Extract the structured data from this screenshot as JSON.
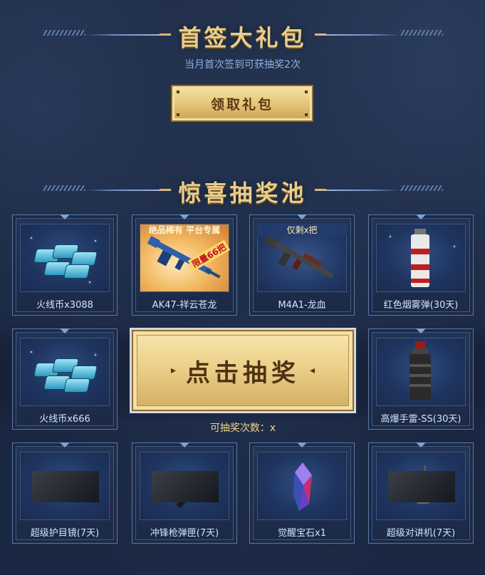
{
  "signin": {
    "title": "首签大礼包",
    "subtitle": "当月首次签到可获抽奖2次",
    "claim_label": "领取礼包"
  },
  "lottery": {
    "title": "惊喜抽奖池",
    "draw_label": "点击抽奖",
    "draws_left": "可抽奖次数：x"
  },
  "prizes": [
    {
      "label": "火线币x3088",
      "icon": "coins-icon"
    },
    {
      "label": "AK47-祥云苍龙",
      "icon": "rifle-icon",
      "tag": "绝品稀有 平台专属",
      "stamp": "限量66把"
    },
    {
      "label": "M4A1-龙血",
      "icon": "rifle-icon",
      "tag": "仅剩x把"
    },
    {
      "label": "红色烟雾弹(30天)",
      "icon": "smoke-grenade-icon"
    },
    {
      "label": "火线币x666",
      "icon": "coins-icon"
    },
    {
      "label": "高爆手雷-SS(30天)",
      "icon": "grenade-icon"
    },
    {
      "label": "超级护目镜(7天)",
      "icon": "goggles-icon"
    },
    {
      "label": "冲锋枪弹匣(7天)",
      "icon": "magazine-icon"
    },
    {
      "label": "觉醒宝石x1",
      "icon": "gem-icon"
    },
    {
      "label": "超级对讲机(7天)",
      "icon": "radio-icon"
    }
  ],
  "colors": {
    "gold": "#e9cd8c",
    "button_gold": "#ecd08a",
    "background": "#1d2a44",
    "card_border": "#5b79a7"
  }
}
